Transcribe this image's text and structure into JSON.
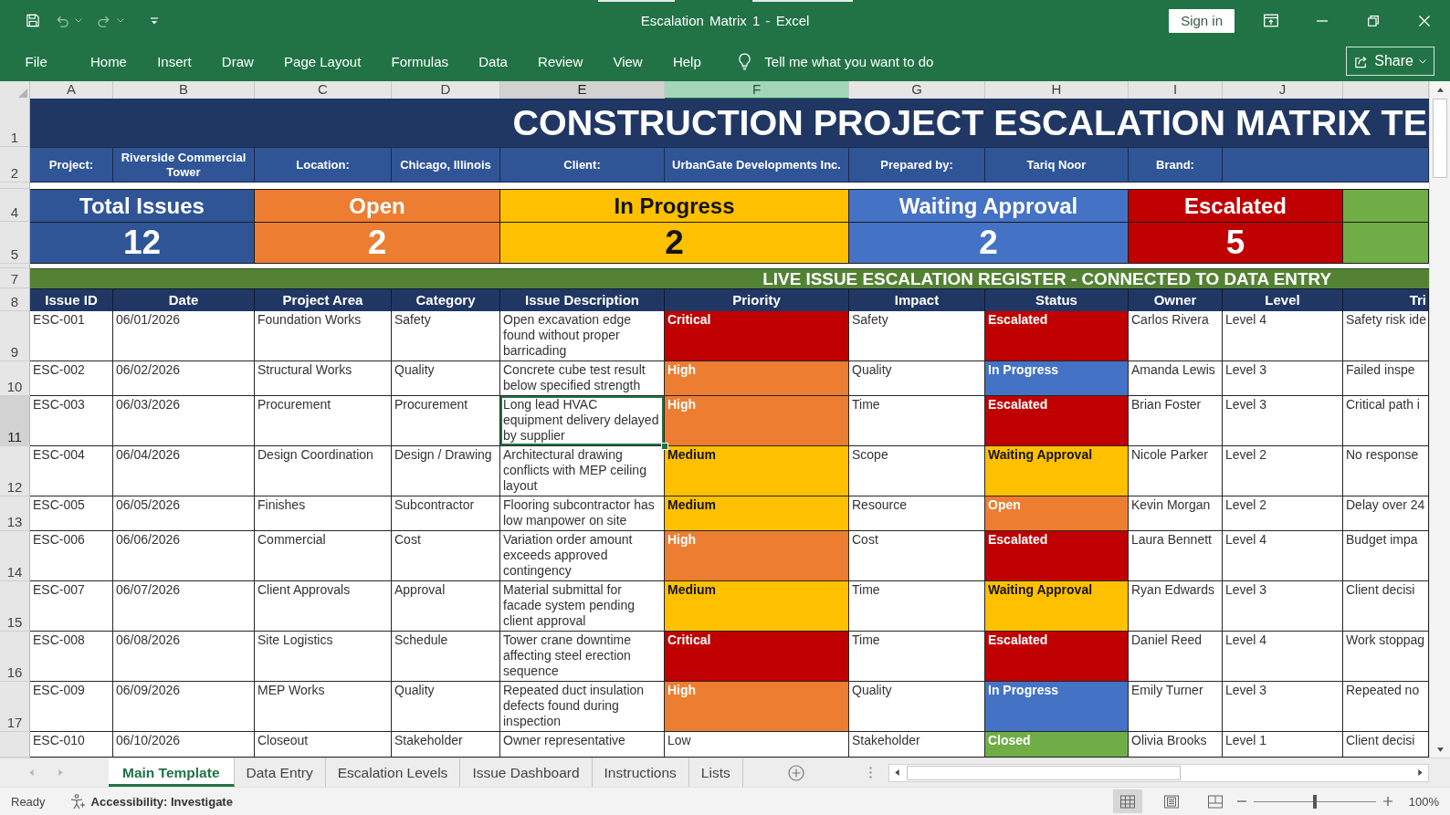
{
  "window": {
    "title": "Escalation Matrix 1 - Excel",
    "sign_in": "Sign in"
  },
  "ribbon": {
    "tabs": [
      "File",
      "Home",
      "Insert",
      "Draw",
      "Page Layout",
      "Formulas",
      "Data",
      "Review",
      "View",
      "Help"
    ],
    "tell_me": "Tell me what you want to do",
    "share": "Share"
  },
  "columns": [
    {
      "letter": "A",
      "selected": false,
      "highlighted": false
    },
    {
      "letter": "B",
      "selected": false,
      "highlighted": false
    },
    {
      "letter": "C",
      "selected": false,
      "highlighted": false
    },
    {
      "letter": "D",
      "selected": false,
      "highlighted": false
    },
    {
      "letter": "E",
      "selected": true,
      "highlighted": false
    },
    {
      "letter": "F",
      "selected": false,
      "highlighted": true
    },
    {
      "letter": "G",
      "selected": false,
      "highlighted": false
    },
    {
      "letter": "H",
      "selected": false,
      "highlighted": false
    },
    {
      "letter": "I",
      "selected": false,
      "highlighted": false
    },
    {
      "letter": "J",
      "selected": false,
      "highlighted": false
    },
    {
      "selected": false,
      "highlighted": false
    }
  ],
  "sheet": {
    "title_row": {
      "number": "1",
      "title": "CONSTRUCTION PROJECT ESCALATION MATRIX TE"
    },
    "info_row": {
      "number": "2",
      "cells": [
        "Project:",
        "Riverside Commercial Tower",
        "Location:",
        "Chicago, Illinois",
        "Client:",
        "UrbanGate Developments Inc.",
        "Prepared by:",
        "Tariq Noor",
        "Brand:"
      ]
    },
    "summary": {
      "row_numbers": [
        "4",
        "5"
      ],
      "cards": [
        {
          "label": "Total Issues",
          "value": "12",
          "color": "#2f5597"
        },
        {
          "label": "Open",
          "value": "2",
          "color": "#ed7d31"
        },
        {
          "label": "In Progress",
          "value": "2",
          "color": "#ffc000"
        },
        {
          "label": "Waiting Approval",
          "value": "2",
          "color": "#4472c4"
        },
        {
          "label": "Escalated",
          "value": "5",
          "color": "#c00000"
        },
        {
          "color": "#70ad47"
        }
      ]
    },
    "band_row": {
      "number": "7",
      "text": "LIVE ISSUE ESCALATION REGISTER - CONNECTED TO DATA ENTRY"
    },
    "header_row": {
      "number": "8",
      "cells": [
        "Issue ID",
        "Date",
        "Project Area",
        "Category",
        "Issue Description",
        "Priority",
        "Impact",
        "Status",
        "Owner",
        "Level",
        "Tri"
      ]
    },
    "rows": [
      {
        "number": "9",
        "selected": false,
        "issue_id": "ESC-001",
        "date": "06/01/2026",
        "project_area": "Foundation Works",
        "category": "Safety",
        "description": "Open excavation edge found without proper barricading",
        "priority": {
          "text": "Critical",
          "color": "#c00000"
        },
        "impact": "Safety",
        "status": {
          "text": "Escalated",
          "color": "#c00000"
        },
        "owner": "Carlos Rivera",
        "level": "Level 4",
        "column_11": "Safety risk ide"
      },
      {
        "number": "10",
        "selected": false,
        "issue_id": "ESC-002",
        "date": "06/02/2026",
        "project_area": "Structural Works",
        "category": "Quality",
        "description": "Concrete cube test result below specified strength",
        "priority": {
          "text": "High",
          "color": "#ed7d31"
        },
        "impact": "Quality",
        "status": {
          "text": "In Progress",
          "color": "#4472c4"
        },
        "owner": "Amanda Lewis",
        "level": "Level 3",
        "column_11": "Failed inspe"
      },
      {
        "number": "11",
        "selected": true,
        "issue_id": "ESC-003",
        "date": "06/03/2026",
        "project_area": "Procurement",
        "category": "Procurement",
        "description": "Long lead HVAC equipment delivery delayed by supplier",
        "priority": {
          "text": "High",
          "color": "#ed7d31"
        },
        "impact": "Time",
        "status": {
          "text": "Escalated",
          "color": "#c00000"
        },
        "owner": "Brian Foster",
        "level": "Level 3",
        "column_11": "Critical path i"
      },
      {
        "number": "12",
        "selected": false,
        "issue_id": "ESC-004",
        "date": "06/04/2026",
        "project_area": "Design Coordination",
        "category": "Design / Drawing",
        "description": "Architectural drawing conflicts with MEP ceiling layout",
        "priority": {
          "text": "Medium",
          "color": "#ffc000"
        },
        "impact": "Scope",
        "status": {
          "text": "Waiting Approval",
          "color": "#ffc000"
        },
        "owner": "Nicole Parker",
        "level": "Level 2",
        "column_11": "No response"
      },
      {
        "number": "13",
        "selected": false,
        "issue_id": "ESC-005",
        "date": "06/05/2026",
        "project_area": "Finishes",
        "category": "Subcontractor",
        "description": "Flooring subcontractor has low manpower on site",
        "priority": {
          "text": "Medium",
          "color": "#ffc000"
        },
        "impact": "Resource",
        "status": {
          "text": "Open",
          "color": "#ed7d31"
        },
        "owner": "Kevin Morgan",
        "level": "Level 2",
        "column_11": "Delay over 24"
      },
      {
        "number": "14",
        "selected": false,
        "issue_id": "ESC-006",
        "date": "06/06/2026",
        "project_area": "Commercial",
        "category": "Cost",
        "description": "Variation order amount exceeds approved contingency",
        "priority": {
          "text": "High",
          "color": "#ed7d31"
        },
        "impact": "Cost",
        "status": {
          "text": "Escalated",
          "color": "#c00000"
        },
        "owner": "Laura Bennett",
        "level": "Level 4",
        "column_11": "Budget impa"
      },
      {
        "number": "15",
        "selected": false,
        "issue_id": "ESC-007",
        "date": "06/07/2026",
        "project_area": "Client Approvals",
        "category": "Approval",
        "description": "Material submittal for facade system pending client approval",
        "priority": {
          "text": "Medium",
          "color": "#ffc000"
        },
        "impact": "Time",
        "status": {
          "text": "Waiting Approval",
          "color": "#ffc000"
        },
        "owner": "Ryan Edwards",
        "level": "Level 3",
        "column_11": "Client decisi"
      },
      {
        "number": "16",
        "selected": false,
        "issue_id": "ESC-008",
        "date": "06/08/2026",
        "project_area": "Site Logistics",
        "category": "Schedule",
        "description": "Tower crane downtime affecting steel erection sequence",
        "priority": {
          "text": "Critical",
          "color": "#c00000"
        },
        "impact": "Time",
        "status": {
          "text": "Escalated",
          "color": "#c00000"
        },
        "owner": "Daniel Reed",
        "level": "Level 4",
        "column_11": "Work stoppag"
      },
      {
        "number": "17",
        "selected": false,
        "issue_id": "ESC-009",
        "date": "06/09/2026",
        "project_area": "MEP Works",
        "category": "Quality",
        "description": "Repeated duct insulation defects found during inspection",
        "priority": {
          "text": "High",
          "color": "#ed7d31"
        },
        "impact": "Quality",
        "status": {
          "text": "In Progress",
          "color": "#4472c4"
        },
        "owner": "Emily Turner",
        "level": "Level 3",
        "column_11": "Repeated no"
      },
      {
        "selected": false,
        "issue_id": "ESC-010",
        "date": "06/10/2026",
        "project_area": "Closeout",
        "category": "Stakeholder",
        "description": "Owner representative",
        "priority": {
          "text": "Low"
        },
        "impact": "Stakeholder",
        "status": {
          "text": "Closed",
          "color": "#70ad47"
        },
        "owner": "Olivia Brooks",
        "level": "Level 1",
        "column_11": "Client decisi"
      }
    ]
  },
  "sheet_tabs": [
    {
      "label": "Main Template",
      "selected": true
    },
    {
      "label": "Data Entry",
      "selected": false
    },
    {
      "label": "Escalation Levels",
      "selected": false
    },
    {
      "label": "Issue Dashboard",
      "selected": false
    },
    {
      "label": "Instructions",
      "selected": false
    },
    {
      "label": "Lists",
      "selected": false
    }
  ],
  "status_bar": {
    "mode": "Ready",
    "accessibility": "Accessibility: Investigate",
    "views": [
      {
        "selected": true
      },
      {
        "selected": false
      },
      {
        "selected": false
      }
    ],
    "zoom": {
      "level": 0.5,
      "percent": "100%"
    }
  }
}
